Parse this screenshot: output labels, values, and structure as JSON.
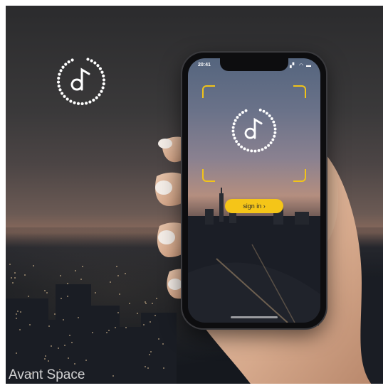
{
  "phone": {
    "status_time": "20:41",
    "status_icons": "▗▘ ◠ ▬"
  },
  "screen": {
    "signin_label": "sign in ›"
  },
  "watermark": "Avant Space",
  "colors": {
    "accent": "#f5c518",
    "frame_corners": "#f2c418",
    "logo_dots": "#ffffff"
  },
  "icons": {
    "sky_logo": "music-note-dotted-circle-icon",
    "screen_logo": "music-note-dotted-circle-icon"
  }
}
